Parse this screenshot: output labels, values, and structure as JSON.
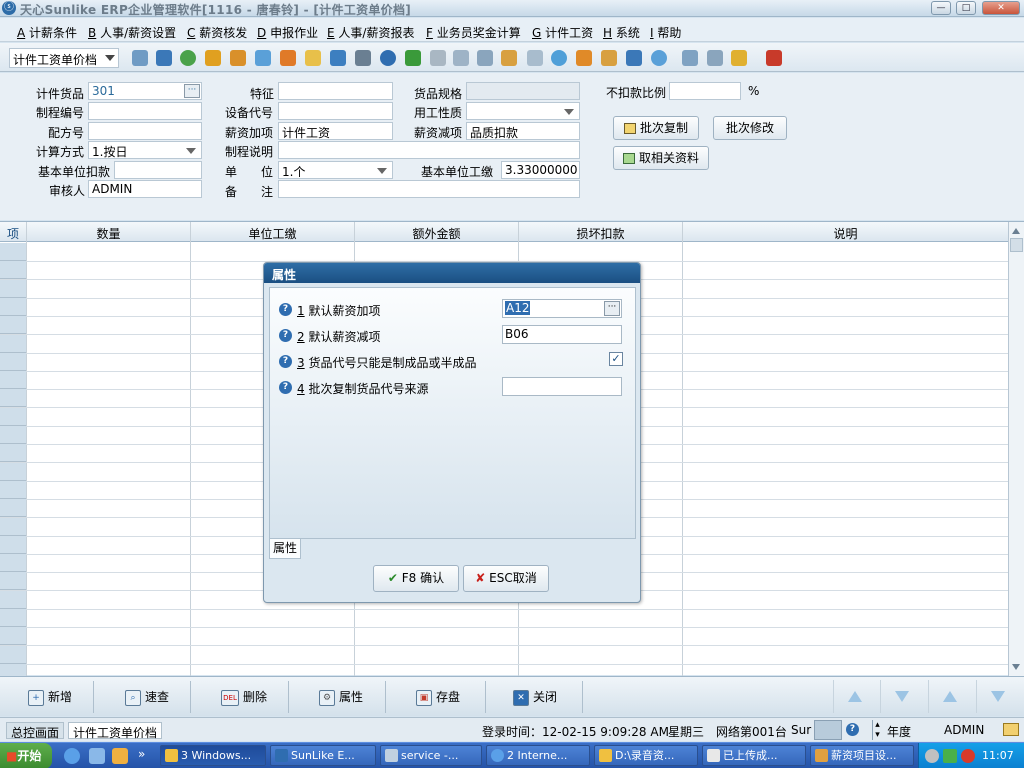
{
  "window": {
    "title": "天心Sunlike ERP企业管理软件[1116 - 唐春铃] - [计件工资单价档]",
    "controls": {
      "minimize": "—",
      "restore": "□",
      "close": "✕"
    }
  },
  "menubar": {
    "items": [
      {
        "key": "A",
        "label": "计薪条件"
      },
      {
        "key": "B",
        "label": "人事/薪资设置"
      },
      {
        "key": "C",
        "label": "薪资核发"
      },
      {
        "key": "D",
        "label": "申报作业"
      },
      {
        "key": "E",
        "label": "人事/薪资报表"
      },
      {
        "key": "F",
        "label": "业务员奖金计算"
      },
      {
        "key": "G",
        "label": "计件工资"
      },
      {
        "key": "H",
        "label": "系统"
      },
      {
        "key": "I",
        "label": "帮助"
      }
    ]
  },
  "toolbar": {
    "doc_selector": "计件工资单价档",
    "icons": [
      "switch-icon",
      "monitor-icon",
      "phone-icon",
      "lock-icon",
      "briefcase-icon",
      "home-icon",
      "puzzle-icon",
      "mail-icon",
      "card-icon",
      "key-icon",
      "help-icon",
      "dollar-icon",
      "cart-icon",
      "chart-icon",
      "calculator-icon",
      "tape-icon",
      "copy-icon",
      "check-icon",
      "bell-icon",
      "org-icon",
      "screen-icon",
      "refresh-icon",
      "window-icon",
      "close-window-icon",
      "layers-icon",
      "exit-icon"
    ]
  },
  "form": {
    "labels": {
      "goods": "计件货品",
      "process_no": "制程编号",
      "recipe_no": "配方号",
      "calc_method": "计算方式",
      "base_unit_deduct": "基本单位扣款",
      "approver": "审核人",
      "feature": "特征",
      "equipment_code": "设备代号",
      "salary_add": "薪资加项",
      "process_desc": "制程说明",
      "unit": "单　　位",
      "remark": "备　　注",
      "spec": "货品规格",
      "work_type": "用工性质",
      "salary_deduct": "薪资减项",
      "base_unit_wage": "基本单位工缴",
      "no_deduct_ratio": "不扣款比例",
      "percent": "%"
    },
    "values": {
      "goods": "301",
      "calc_method": "1.按日",
      "approver": "ADMIN",
      "salary_add": "计件工资",
      "unit": "1.个",
      "salary_deduct": "品质扣款",
      "base_unit_wage": "3.33000000"
    },
    "buttons": {
      "batch_copy": "批次复制",
      "batch_modify": "批次修改",
      "fetch_related": "取相关资料"
    }
  },
  "grid": {
    "columns": [
      "项",
      "数量",
      "单位工缴",
      "额外金额",
      "损坏扣款",
      "说明"
    ]
  },
  "dialog": {
    "title": "属性",
    "properties": [
      {
        "num": "1",
        "label": "默认薪资加项",
        "value": "A12"
      },
      {
        "num": "2",
        "label": "默认薪资减项",
        "value": "B06"
      },
      {
        "num": "3",
        "label": "货品代号只能是制成品或半成品",
        "checked": true
      },
      {
        "num": "4",
        "label": "批次复制货品代号来源",
        "value": ""
      }
    ],
    "tab": "属性",
    "ok_label": "F8 确认",
    "cancel_label": "ESC取消"
  },
  "actionbar": {
    "buttons": [
      {
        "label": "新增",
        "icon": "add-icon"
      },
      {
        "label": "速查",
        "icon": "search-icon"
      },
      {
        "label": "删除",
        "icon": "delete-icon",
        "badge": "DEL"
      },
      {
        "label": "属性",
        "icon": "properties-icon"
      },
      {
        "label": "存盘",
        "icon": "save-icon"
      },
      {
        "label": "关闭",
        "icon": "close-icon"
      }
    ]
  },
  "statusbar": {
    "tab_main": "总控画面",
    "tab_current": "计件工资单价档",
    "login_time": "登录时间：12-02-15 9:09:28 AM",
    "weekday": "星期三",
    "network": "网络第001台",
    "cut_text": "Sur",
    "year": "年度",
    "user": "ADMIN"
  },
  "taskbar": {
    "start": "开始",
    "chevron": "»",
    "tasks": [
      {
        "label": "3 Windows..."
      },
      {
        "label": "SunLike E..."
      },
      {
        "label": "service -..."
      },
      {
        "label": "2 Interne..."
      },
      {
        "label": "D:\\录音资..."
      },
      {
        "label": "已上传成..."
      },
      {
        "label": "薪资项目设..."
      }
    ],
    "clock": "11:07"
  },
  "colors": {
    "title_blue": "#1b4f82",
    "accent": "#2f6db0",
    "taskbar": "#2553a8"
  }
}
